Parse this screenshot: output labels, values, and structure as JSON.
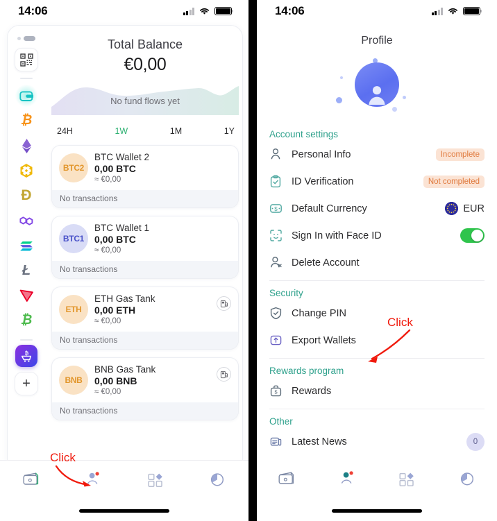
{
  "status_bar": {
    "time": "14:06",
    "cellular_icon": "signal-bars-icon",
    "wifi_icon": "wifi-icon",
    "battery_icon": "battery-full-icon"
  },
  "left_screen": {
    "rail": {
      "qr_icon": "qr-code-icon",
      "items": [
        {
          "name": "wallet",
          "glyph": "▤",
          "color": "#17c3c3",
          "active": true
        },
        {
          "name": "bitcoin",
          "glyph": "₿",
          "color": "#f7931a",
          "active": false
        },
        {
          "name": "ethereum",
          "glyph": "⧫",
          "color": "#8a63d2",
          "active": false
        },
        {
          "name": "bnb",
          "glyph": "⬡",
          "color": "#f0b90b",
          "active": false
        },
        {
          "name": "dogecoin",
          "glyph": "Ð",
          "color": "#c2a633",
          "active": false
        },
        {
          "name": "polygon",
          "glyph": "⬡",
          "color": "#8247e5",
          "active": false
        },
        {
          "name": "solana",
          "glyph": "≡",
          "color": "#00d18c",
          "active": false
        },
        {
          "name": "litecoin",
          "glyph": "Ł",
          "color": "#838c98",
          "active": false
        },
        {
          "name": "tron",
          "glyph": "▼",
          "color": "#eb0029",
          "active": false
        },
        {
          "name": "bitcoin-cash",
          "glyph": "Ƀ",
          "color": "#4dbb4d",
          "active": false
        }
      ],
      "shop_glyph": "Ƀ",
      "add_label": "+"
    },
    "balance": {
      "title": "Total Balance",
      "amount": "€0,00"
    },
    "chart": {
      "empty_text": "No fund flows yet"
    },
    "ranges": [
      {
        "label": "24H",
        "selected": false
      },
      {
        "label": "1W",
        "selected": true
      },
      {
        "label": "1M",
        "selected": false
      },
      {
        "label": "1Y",
        "selected": false
      }
    ],
    "wallets": [
      {
        "ticker": "BTC2",
        "name": "BTC Wallet 2",
        "amount": "0,00 BTC",
        "fiat": "≈ €0,00",
        "footer": "No transactions",
        "avatar_bg": "#fae2c4",
        "avatar_fg": "#e2962c",
        "gas": false
      },
      {
        "ticker": "BTC1",
        "name": "BTC Wallet 1",
        "amount": "0,00 BTC",
        "fiat": "≈ €0,00",
        "footer": "No transactions",
        "avatar_bg": "#d9dcf6",
        "avatar_fg": "#4a52c9",
        "gas": false
      },
      {
        "ticker": "ETH",
        "name": "ETH Gas Tank",
        "amount": "0,00 ETH",
        "fiat": "≈ €0,00",
        "footer": "No transactions",
        "avatar_bg": "#fae2c4",
        "avatar_fg": "#e2962c",
        "gas": true
      },
      {
        "ticker": "BNB",
        "name": "BNB Gas Tank",
        "amount": "0,00 BNB",
        "fiat": "≈ €0,00",
        "footer": "No transactions",
        "avatar_bg": "#fae2c4",
        "avatar_fg": "#e2962c",
        "gas": true
      }
    ],
    "tabs": [
      {
        "name": "wallet-tab",
        "icon": "wallet-icon",
        "active": false
      },
      {
        "name": "profile-tab",
        "icon": "profile-face-icon",
        "active": true
      },
      {
        "name": "apps-tab",
        "icon": "apps-grid-icon",
        "active": false
      },
      {
        "name": "portfolio-tab",
        "icon": "pie-chart-icon",
        "active": false
      }
    ],
    "annotation": {
      "label": "Click"
    }
  },
  "right_screen": {
    "title": "Profile",
    "avatar_icon": "user-avatar-icon",
    "sections": [
      {
        "title": "Account settings",
        "rows": [
          {
            "icon": "person-icon",
            "label": "Personal Info",
            "badge": "Incomplete",
            "control": "badge"
          },
          {
            "icon": "id-clipboard-icon",
            "label": "ID Verification",
            "badge": "Not completed",
            "control": "badge"
          },
          {
            "icon": "currency-icon",
            "label": "Default Currency",
            "value": "EUR",
            "control": "currency"
          },
          {
            "icon": "face-id-icon",
            "label": "Sign In with Face ID",
            "control": "toggle",
            "toggle_on": true
          },
          {
            "icon": "person-delete-icon",
            "label": "Delete Account",
            "control": "none"
          }
        ]
      },
      {
        "title": "Security",
        "rows": [
          {
            "icon": "shield-check-icon",
            "label": "Change PIN",
            "control": "none"
          },
          {
            "icon": "export-upload-icon",
            "label": "Export Wallets",
            "control": "none"
          }
        ]
      },
      {
        "title": "Rewards program",
        "rows": [
          {
            "icon": "briefcase-dollar-icon",
            "label": "Rewards",
            "control": "none"
          }
        ]
      },
      {
        "title": "Other",
        "rows": [
          {
            "icon": "news-icon",
            "label": "Latest News",
            "value": "0",
            "control": "count"
          }
        ]
      }
    ],
    "tabs": [
      {
        "name": "wallet-tab",
        "icon": "wallet-icon",
        "active": false
      },
      {
        "name": "profile-tab",
        "icon": "profile-face-icon",
        "active": true
      },
      {
        "name": "apps-tab",
        "icon": "apps-grid-icon",
        "active": false
      },
      {
        "name": "portfolio-tab",
        "icon": "pie-chart-icon",
        "active": false
      }
    ],
    "annotation": {
      "label": "Click"
    }
  },
  "colors": {
    "accent_green": "#2fb173",
    "section_title": "#2fa18c",
    "badge_bg": "#fbe3d4",
    "badge_text": "#e07a3e",
    "toggle_on": "#2fc44c",
    "annotation_red": "#f01a0d"
  }
}
